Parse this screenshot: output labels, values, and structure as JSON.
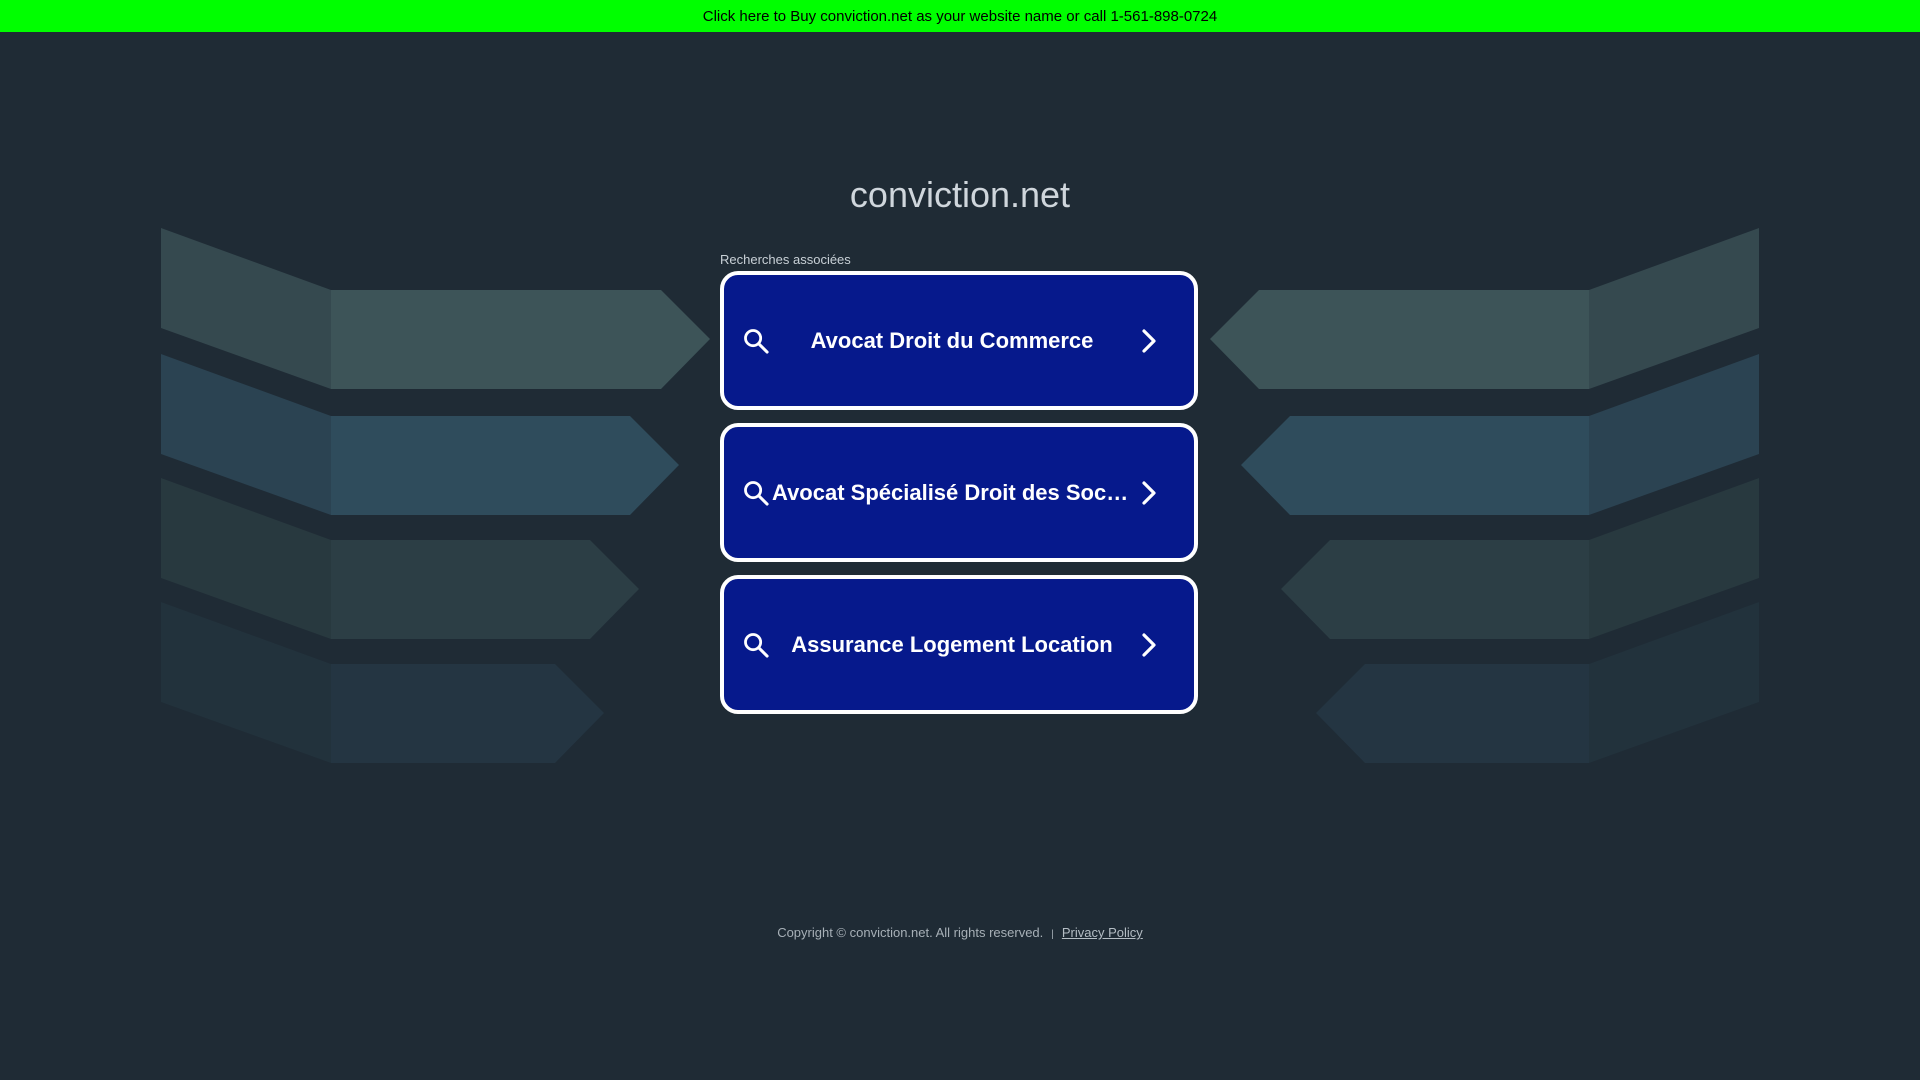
{
  "banner": {
    "text": "Click here to Buy conviction.net as your website name or call 1-561-898-0724"
  },
  "site": {
    "title": "conviction.net"
  },
  "related": {
    "heading": "Recherches associées",
    "items": [
      {
        "label": "Avocat Droit du Commerce",
        "icon": "search-icon",
        "arrow": "chevron-right-icon"
      },
      {
        "label": "Avocat Spécialisé Droit des Sociétés",
        "icon": "search-icon",
        "arrow": "chevron-right-icon"
      },
      {
        "label": "Assurance Logement Location",
        "icon": "search-icon",
        "arrow": "chevron-right-icon"
      }
    ]
  },
  "footer": {
    "copyright": "Copyright © conviction.net.  All rights reserved.",
    "separator": "|",
    "privacy": "Privacy Policy"
  },
  "colors": {
    "background": "#1f2b35",
    "banner": "#00ff00",
    "tile": "#06198c",
    "tile_border": "#ffffff"
  }
}
